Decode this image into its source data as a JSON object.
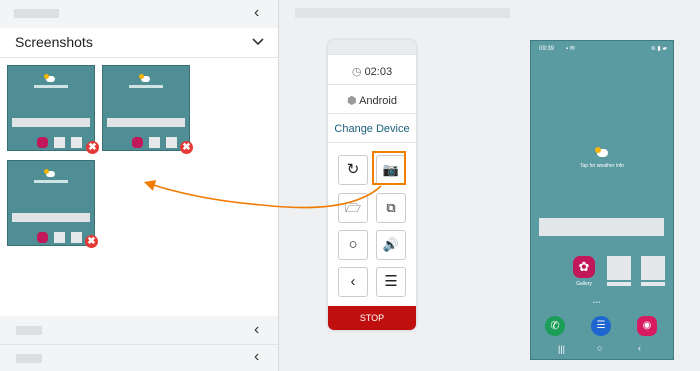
{
  "left_panel": {
    "screenshots_title": "Screenshots",
    "thumbnails": [
      {
        "caption": "Tap for weather info"
      },
      {
        "caption": "Tap for weather info"
      },
      {
        "caption": "Tap for weather info"
      }
    ],
    "delete_symbol": "✖"
  },
  "controls": {
    "timer": "02:03",
    "os_label": "Android",
    "change_device": "Change Device",
    "stop": "STOP",
    "buttons": [
      "rotate",
      "screenshot",
      "folder",
      "copy",
      "home",
      "volume",
      "back",
      "menu"
    ]
  },
  "phone": {
    "status_time": "09:39",
    "weather_text": "Tap for weather info",
    "gallery_label": "Gallery"
  },
  "colors": {
    "accent": "#f07c00",
    "stop": "#c00f0f",
    "phone_bg": "#5a9aa1",
    "link": "#1a5f7a"
  }
}
